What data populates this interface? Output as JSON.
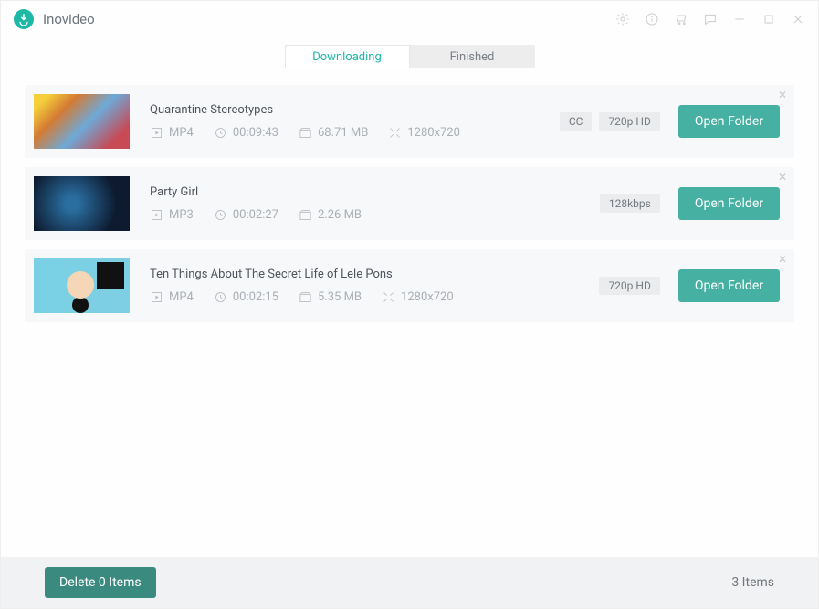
{
  "app": {
    "title": "Inovideo"
  },
  "tabs": {
    "downloading": "Downloading",
    "finished": "Finished",
    "active": "downloading"
  },
  "items": [
    {
      "title": "Quarantine Stereotypes",
      "format": "MP4",
      "duration": "00:09:43",
      "size": "68.71 MB",
      "resolution": "1280x720",
      "badges": [
        "CC",
        "720p HD"
      ],
      "action": "Open Folder"
    },
    {
      "title": "Party Girl",
      "format": "MP3",
      "duration": "00:02:27",
      "size": "2.26 MB",
      "resolution": "",
      "badges": [
        "128kbps"
      ],
      "action": "Open Folder"
    },
    {
      "title": "Ten Things About The Secret Life of Lele Pons",
      "format": "MP4",
      "duration": "00:02:15",
      "size": "5.35 MB",
      "resolution": "1280x720",
      "badges": [
        "720p HD"
      ],
      "action": "Open Folder"
    }
  ],
  "footer": {
    "delete": "Delete 0 Items",
    "count": "3 Items"
  }
}
